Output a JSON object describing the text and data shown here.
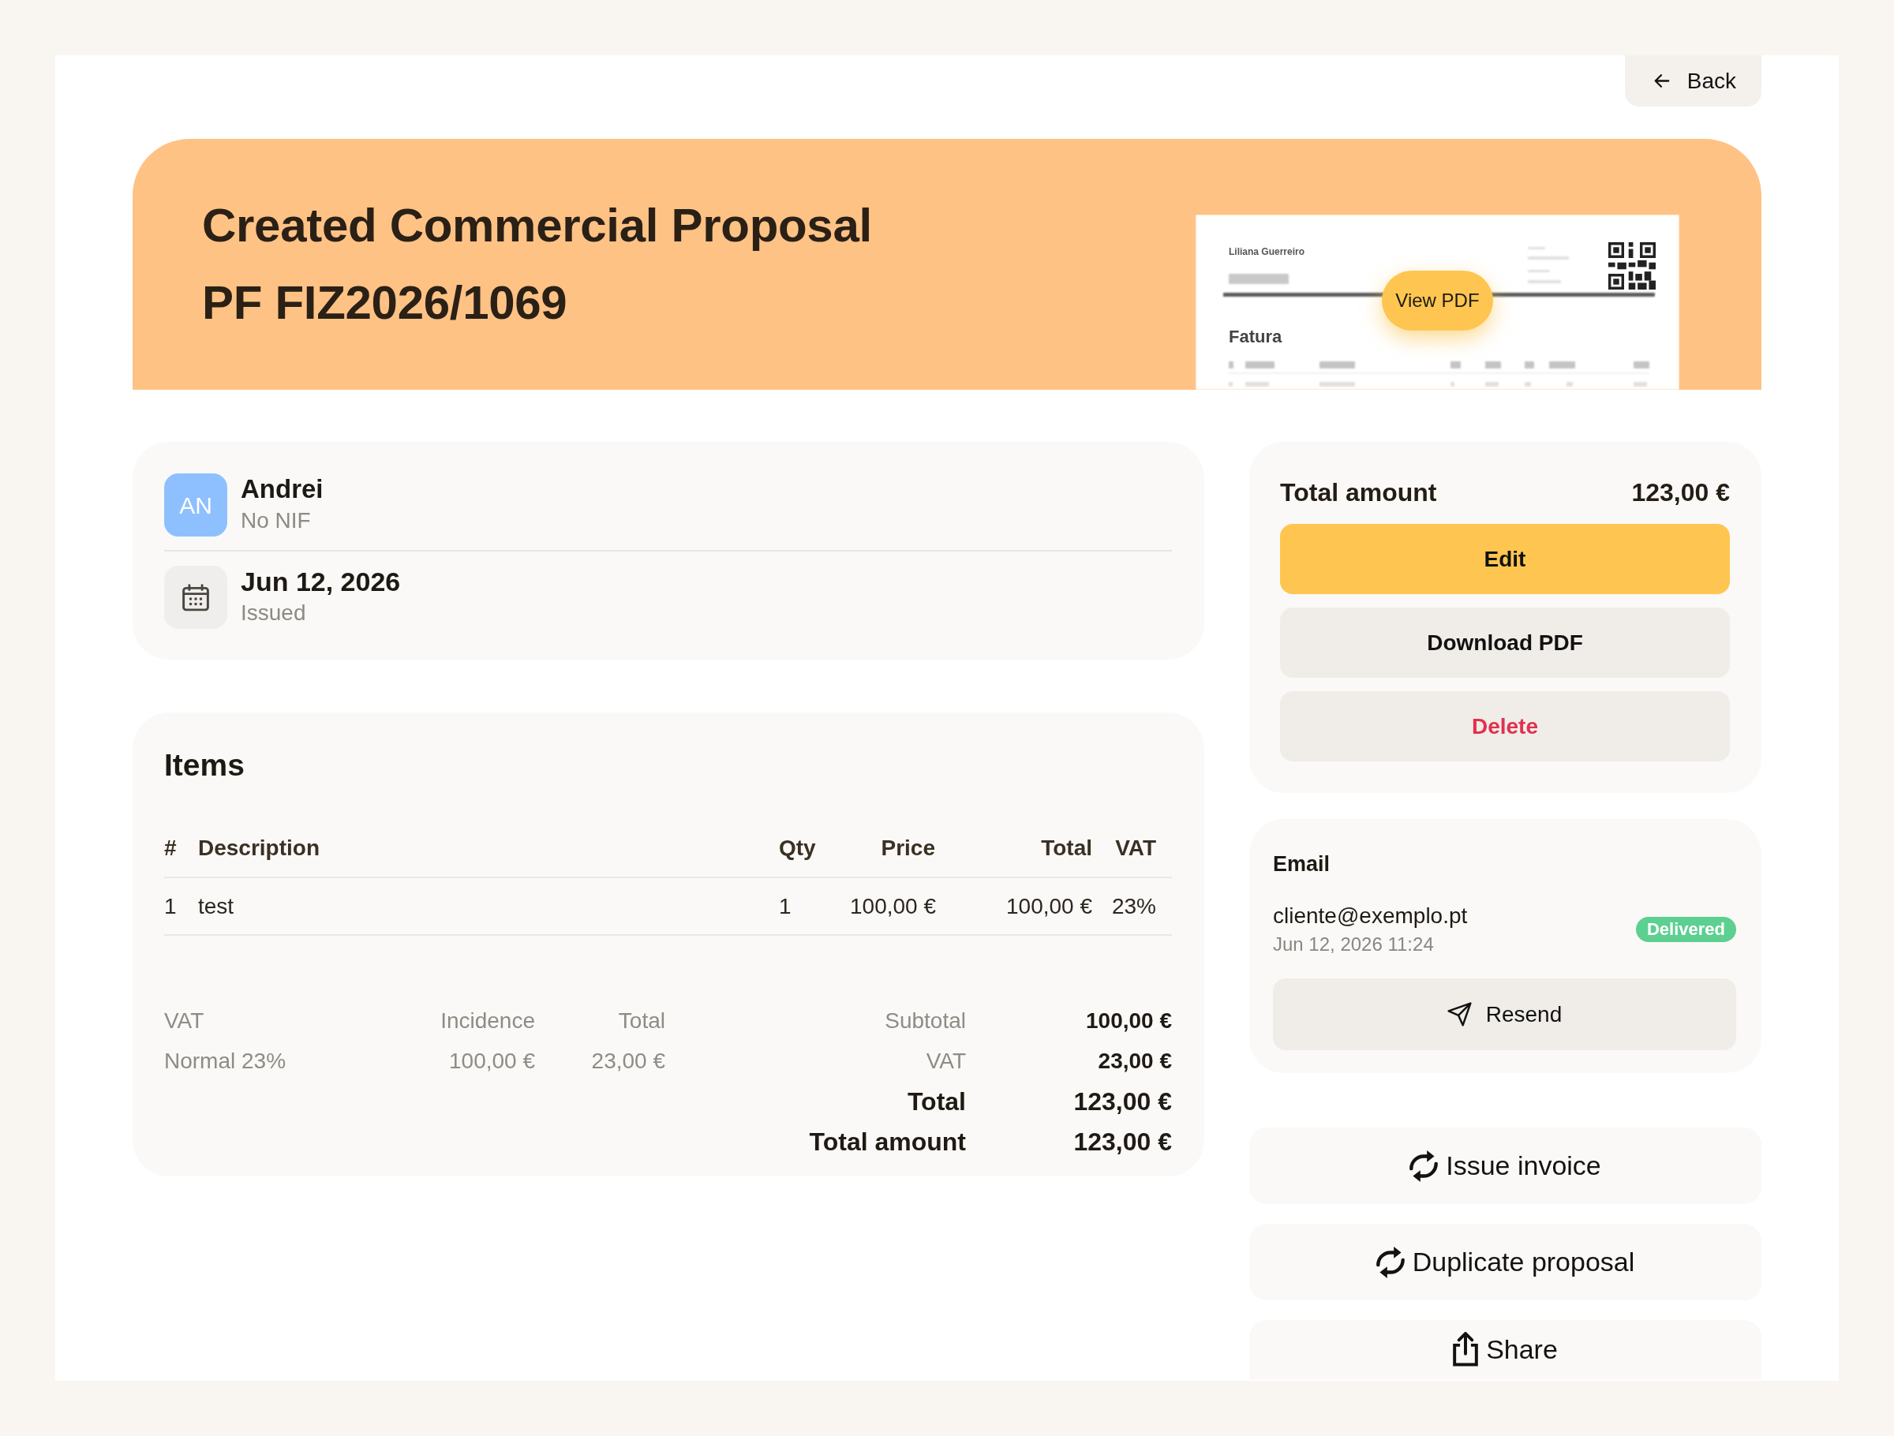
{
  "back_button": {
    "label": "Back"
  },
  "header": {
    "title": "Created Commercial Proposal",
    "document_number": "PF FIZ2026/1069",
    "preview": {
      "sender": "Liliana Guerreiro",
      "document_title": "Fatura",
      "button": "View PDF"
    }
  },
  "client": {
    "initials": "AN",
    "name": "Andrei",
    "tax_id": "No NIF"
  },
  "issue_date": {
    "date": "Jun 12, 2026",
    "label": "Issued"
  },
  "items": {
    "title": "Items",
    "columns": [
      "#",
      "Description",
      "Qty",
      "Price",
      "Total",
      "VAT"
    ],
    "rows": [
      [
        "1",
        "test",
        "1",
        "100,00 €",
        "100,00 €",
        "23%"
      ]
    ]
  },
  "vat_summary": {
    "columns": [
      "VAT",
      "Incidence",
      "Total"
    ],
    "rows": [
      [
        "Normal 23%",
        "100,00 €",
        "23,00 €"
      ]
    ]
  },
  "totals": [
    {
      "label": "Subtotal",
      "value": "100,00 €",
      "emphasized": false
    },
    {
      "label": "VAT",
      "value": "23,00 €",
      "emphasized": false
    },
    {
      "label": "Total",
      "value": "123,00 €",
      "emphasized": true
    },
    {
      "label": "Total amount",
      "value": "123,00 €",
      "emphasized": true
    }
  ],
  "amount_panel": {
    "label": "Total amount",
    "value": "123,00 €",
    "buttons": [
      {
        "label": "Edit",
        "kind": "primary"
      },
      {
        "label": "Download PDF",
        "kind": "secondary"
      },
      {
        "label": "Delete",
        "kind": "danger"
      }
    ]
  },
  "email": {
    "title": "Email",
    "address": "cliente@exemplo.pt",
    "sent_at": "Jun 12, 2026 11:24",
    "status": "Delivered",
    "button": "Resend"
  },
  "actions": [
    {
      "label": "Issue invoice",
      "kind": "repeat"
    },
    {
      "label": "Duplicate proposal",
      "kind": "repeat"
    },
    {
      "label": "Share",
      "kind": "share"
    }
  ]
}
